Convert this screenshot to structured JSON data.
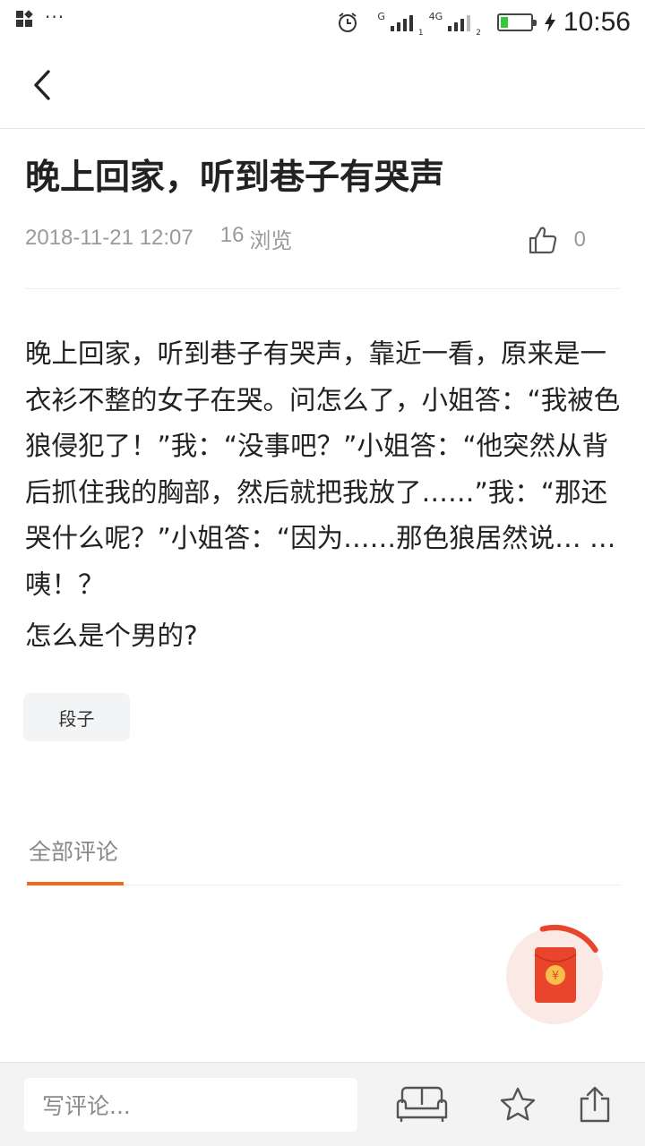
{
  "status_bar": {
    "time": "10:56",
    "network_1": "G",
    "network_2": "4G",
    "sim_1": "1",
    "sim_2": "2",
    "dots": "···"
  },
  "article": {
    "title": "晚上回家，听到巷子有哭声",
    "date": "2018-11-21 12:07",
    "views_count": "16",
    "views_label": "浏览",
    "like_count": "0",
    "paragraph_1": "晚上回家，听到巷子有哭声，靠近一看，原来是一衣衫不整的女子在哭。问怎么了，小姐答：“我被色狼侵犯了！”我：“没事吧？”小姐答：“他突然从背后抓住我的胸部，然后就把我放了……”我：“那还哭什么呢？”小姐答：“因为……那色狼居然说… …咦！？",
    "paragraph_2": "怎么是个男的?",
    "tag": "段子"
  },
  "comments": {
    "tab_label": "全部评论"
  },
  "bottom_bar": {
    "input_placeholder": "写评论..."
  },
  "icons": {
    "back": "chevron-left-icon",
    "like": "thumbs-up-icon",
    "sofa": "sofa-icon",
    "favorite": "star-icon",
    "share": "share-icon",
    "red_packet": "red-envelope-icon",
    "alarm": "alarm-clock-icon",
    "charging": "lightning-icon"
  },
  "colors": {
    "accent": "#f36a1c",
    "red_packet": "#e8452c",
    "battery": "#36c83b"
  },
  "red_packet": {
    "coin_symbol": "¥",
    "progress": 0.2
  }
}
